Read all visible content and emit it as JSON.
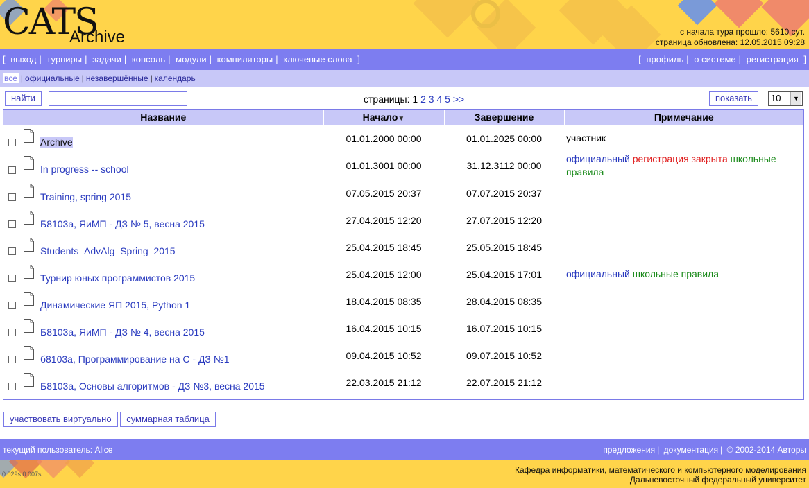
{
  "header": {
    "logo_text": "CATS",
    "title": "Archive",
    "elapsed": "с начала тура прошло: 5610 сут.",
    "updated": "страница обновлена: 12.05.2015 09:28"
  },
  "topnav": {
    "left": [
      "выход",
      "турниры",
      "задачи",
      "консоль",
      "модули",
      "компиляторы",
      "ключевые слова"
    ],
    "right": [
      "профиль",
      "о системе",
      "регистрация"
    ]
  },
  "subnav": [
    "все",
    "официальные",
    "незавершённые",
    "календарь"
  ],
  "toolbar": {
    "search_button": "найти",
    "search_value": "",
    "pages_label": "страницы:",
    "current_page": "1",
    "pages": [
      "2",
      "3",
      "4",
      "5"
    ],
    "next": ">>",
    "show_button": "показать",
    "rows_per_page": "10"
  },
  "table": {
    "columns": [
      "Название",
      "Начало",
      "Завершение",
      "Примечание"
    ],
    "rows": [
      {
        "name": "Archive",
        "start": "01.01.2000 00:00",
        "end": "01.01.2025 00:00",
        "note_plain": "участник"
      },
      {
        "name": "In progress -- school",
        "start": "01.01.3001 00:00",
        "end": "31.12.3112 00:00",
        "note_official": "официальный",
        "note_closed": "регистрация закрыта",
        "note_school": "школьные правила"
      },
      {
        "name": "Training, spring 2015",
        "start": "07.05.2015 20:37",
        "end": "07.07.2015 20:37"
      },
      {
        "name": "Б8103а, ЯиМП - ДЗ № 5, весна 2015",
        "start": "27.04.2015 12:20",
        "end": "27.07.2015 12:20"
      },
      {
        "name": "Students_AdvAlg_Spring_2015",
        "start": "25.04.2015 18:45",
        "end": "25.05.2015 18:45"
      },
      {
        "name": "Турнир юных программистов 2015",
        "start": "25.04.2015 12:00",
        "end": "25.04.2015 17:01",
        "note_official": "официальный",
        "note_school": "школьные правила"
      },
      {
        "name": "Динамические ЯП 2015, Python 1",
        "start": "18.04.2015 08:35",
        "end": "28.04.2015 08:35"
      },
      {
        "name": "Б8103а, ЯиМП - ДЗ № 4, весна 2015",
        "start": "16.04.2015 10:15",
        "end": "16.07.2015 10:15"
      },
      {
        "name": "б8103а, Программирование на С - ДЗ №1",
        "start": "09.04.2015 10:52",
        "end": "09.07.2015 10:52"
      },
      {
        "name": "Б8103а, Основы алгоритмов - ДЗ №3, весна 2015",
        "start": "22.03.2015 21:12",
        "end": "22.07.2015 21:12"
      }
    ]
  },
  "actions": {
    "virtual": "участвовать виртуально",
    "summary": "суммарная таблица"
  },
  "footer": {
    "user": "текущий пользователь: Alice",
    "links": [
      "предложения",
      "документация"
    ],
    "copyright": "© 2002-2014 Авторы",
    "timing": "0.029s 0.007s",
    "dept_line1": "Кафедра информатики, математического и компьютерного моделирования",
    "dept_line2": "Дальневосточный федеральный университет"
  }
}
